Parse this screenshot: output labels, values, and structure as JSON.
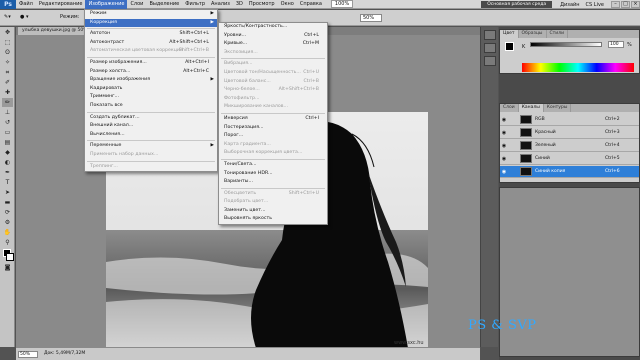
{
  "app": {
    "logo": "Ps"
  },
  "menubar": {
    "items": [
      "Файл",
      "Редактирование",
      "Изображение",
      "Слои",
      "Выделение",
      "Фильтр",
      "Анализ",
      "3D",
      "Просмотр",
      "Окно",
      "Справка"
    ],
    "workspace": "Основная рабочая среда",
    "design": "Дизайн",
    "cs_live": "CS Live",
    "zoom": "100%"
  },
  "options": {
    "mode_label": "Режим:",
    "value": "50%"
  },
  "document": {
    "tab_title": "улыбка девушки.jpg @ 50% (RGB/8*)",
    "zoom": "50%",
    "doc_size": "Док: 5,49M/7,32M",
    "photo_credit": "www.sxc.hu"
  },
  "image_menu": {
    "items": [
      {
        "label": "Режим",
        "arrow": true
      },
      {
        "label": "Коррекция",
        "arrow": true,
        "highlight": true
      },
      {
        "sep": true
      },
      {
        "label": "Автотон",
        "shortcut": "Shift+Ctrl+L"
      },
      {
        "label": "Автоконтраст",
        "shortcut": "Alt+Shift+Ctrl+L"
      },
      {
        "label": "Автоматическая цветовая коррекция",
        "shortcut": "Shift+Ctrl+B",
        "disabled": true
      },
      {
        "sep": true
      },
      {
        "label": "Размер изображения...",
        "shortcut": "Alt+Ctrl+I"
      },
      {
        "label": "Размер холста...",
        "shortcut": "Alt+Ctrl+C"
      },
      {
        "label": "Вращение изображения",
        "arrow": true
      },
      {
        "label": "Кадрировать"
      },
      {
        "label": "Тримминг..."
      },
      {
        "label": "Показать все"
      },
      {
        "sep": true
      },
      {
        "label": "Создать дубликат..."
      },
      {
        "label": "Внешний канал..."
      },
      {
        "label": "Вычисления..."
      },
      {
        "sep": true
      },
      {
        "label": "Переменные",
        "arrow": true
      },
      {
        "label": "Применить набор данных...",
        "disabled": true
      },
      {
        "sep": true
      },
      {
        "label": "Треппинг...",
        "disabled": true
      }
    ]
  },
  "adjust_menu": {
    "items": [
      {
        "label": "Яркость/Контрастность..."
      },
      {
        "label": "Уровни...",
        "shortcut": "Ctrl+L"
      },
      {
        "label": "Кривые...",
        "shortcut": "Ctrl+M"
      },
      {
        "label": "Экспозиция...",
        "disabled": true
      },
      {
        "sep": true
      },
      {
        "label": "Вибрация...",
        "disabled": true
      },
      {
        "label": "Цветовой тон/Насыщенность...",
        "shortcut": "Ctrl+U",
        "disabled": true
      },
      {
        "label": "Цветовой баланс...",
        "shortcut": "Ctrl+B",
        "disabled": true
      },
      {
        "label": "Черно-белое...",
        "shortcut": "Alt+Shift+Ctrl+B",
        "disabled": true
      },
      {
        "label": "Фотофильтр...",
        "disabled": true
      },
      {
        "label": "Микширование каналов...",
        "disabled": true
      },
      {
        "sep": true
      },
      {
        "label": "Инверсия",
        "shortcut": "Ctrl+I"
      },
      {
        "label": "Постеризация..."
      },
      {
        "label": "Порог..."
      },
      {
        "label": "Карта градиента...",
        "disabled": true
      },
      {
        "label": "Выборочная коррекция цвета...",
        "disabled": true
      },
      {
        "sep": true
      },
      {
        "label": "Тени/Света..."
      },
      {
        "label": "Тонирование HDR..."
      },
      {
        "label": "Варианты..."
      },
      {
        "sep": true
      },
      {
        "label": "Обесцветить",
        "shortcut": "Shift+Ctrl+U",
        "disabled": true
      },
      {
        "label": "Подобрать цвет...",
        "disabled": true
      },
      {
        "label": "Заменить цвет..."
      },
      {
        "label": "Выровнять яркость"
      }
    ]
  },
  "color_panel": {
    "tabs": [
      "Цвет",
      "Образцы",
      "Стили"
    ],
    "channel": "K",
    "value": "100",
    "unit": "%"
  },
  "channels_panel": {
    "tabs": [
      "Слои",
      "Каналы",
      "Контуры"
    ],
    "rows": [
      {
        "name": "RGB",
        "shortcut": "Ctrl+2"
      },
      {
        "name": "Красный",
        "shortcut": "Ctrl+3"
      },
      {
        "name": "Зеленый",
        "shortcut": "Ctrl+4"
      },
      {
        "name": "Синий",
        "shortcut": "Ctrl+5"
      },
      {
        "name": "Синий копия",
        "shortcut": "Ctrl+6",
        "selected": true
      }
    ]
  },
  "watermark": "PS & SVP"
}
